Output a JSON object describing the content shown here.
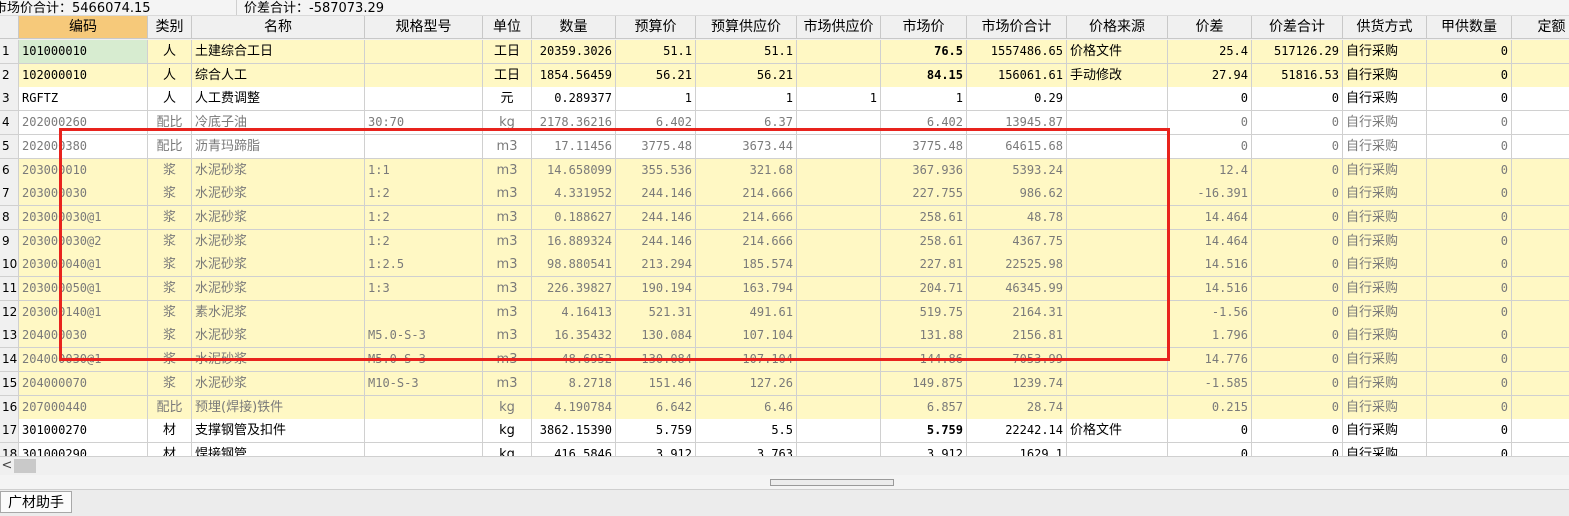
{
  "summary": {
    "market_total": "市场价合计：5466074.15",
    "diff_total": "价差合计：-587073.29"
  },
  "columns": [
    "",
    "编码",
    "类别",
    "名称",
    "规格型号",
    "单位",
    "数量",
    "预算价",
    "预算供应价",
    "市场供应价",
    "市场价",
    "市场价合计",
    "价格来源",
    "价差",
    "价差合计",
    "供货方式",
    "甲供数量",
    "定额"
  ],
  "rows": [
    {
      "n": "1",
      "code": "101000010",
      "cat": "人",
      "name": "土建综合工日",
      "spec": "",
      "unit": "工日",
      "qty": "20359.3026",
      "budget": "51.1",
      "budget_supply": "51.1",
      "market_supply": "",
      "market": "76.5",
      "market_total": "1557486.65",
      "source": "价格文件",
      "diff": "25.4",
      "diff_total": "517126.29",
      "supply": "自行采购",
      "a_qty": "0"
    },
    {
      "n": "2",
      "code": "102000010",
      "cat": "人",
      "name": "综合人工",
      "spec": "",
      "unit": "工日",
      "qty": "1854.56459",
      "budget": "56.21",
      "budget_supply": "56.21",
      "market_supply": "",
      "market": "84.15",
      "market_total": "156061.61",
      "source": "手动修改",
      "diff": "27.94",
      "diff_total": "51816.53",
      "supply": "自行采购",
      "a_qty": "0"
    },
    {
      "n": "3",
      "code": "RGFTZ",
      "cat": "人",
      "name": "人工费调整",
      "spec": "",
      "unit": "元",
      "qty": "0.289377",
      "budget": "1",
      "budget_supply": "1",
      "market_supply": "1",
      "market": "1",
      "market_total": "0.29",
      "source": "",
      "diff": "0",
      "diff_total": "0",
      "supply": "自行采购",
      "a_qty": "0"
    },
    {
      "n": "4",
      "code": "202000260",
      "cat": "配比",
      "name": "冷底子油",
      "spec": "30:70",
      "unit": "kg",
      "qty": "2178.36216",
      "budget": "6.402",
      "budget_supply": "6.37",
      "market_supply": "",
      "market": "6.402",
      "market_total": "13945.87",
      "source": "",
      "diff": "0",
      "diff_total": "0",
      "supply": "自行采购",
      "a_qty": "0"
    },
    {
      "n": "5",
      "code": "202000380",
      "cat": "配比",
      "name": "沥青玛蹄脂",
      "spec": "",
      "unit": "m3",
      "qty": "17.11456",
      "budget": "3775.48",
      "budget_supply": "3673.44",
      "market_supply": "",
      "market": "3775.48",
      "market_total": "64615.68",
      "source": "",
      "diff": "0",
      "diff_total": "0",
      "supply": "自行采购",
      "a_qty": "0"
    },
    {
      "n": "6",
      "code": "203000010",
      "cat": "浆",
      "name": "水泥砂浆",
      "spec": "1:1",
      "unit": "m3",
      "qty": "14.658099",
      "budget": "355.536",
      "budget_supply": "321.68",
      "market_supply": "",
      "market": "367.936",
      "market_total": "5393.24",
      "source": "",
      "diff": "12.4",
      "diff_total": "0",
      "supply": "自行采购",
      "a_qty": "0"
    },
    {
      "n": "7",
      "code": "203000030",
      "cat": "浆",
      "name": "水泥砂浆",
      "spec": "1:2",
      "unit": "m3",
      "qty": "4.331952",
      "budget": "244.146",
      "budget_supply": "214.666",
      "market_supply": "",
      "market": "227.755",
      "market_total": "986.62",
      "source": "",
      "diff": "-16.391",
      "diff_total": "0",
      "supply": "自行采购",
      "a_qty": "0"
    },
    {
      "n": "8",
      "code": "203000030@1",
      "cat": "浆",
      "name": "水泥砂浆",
      "spec": "1:2",
      "unit": "m3",
      "qty": "0.188627",
      "budget": "244.146",
      "budget_supply": "214.666",
      "market_supply": "",
      "market": "258.61",
      "market_total": "48.78",
      "source": "",
      "diff": "14.464",
      "diff_total": "0",
      "supply": "自行采购",
      "a_qty": "0"
    },
    {
      "n": "9",
      "code": "203000030@2",
      "cat": "浆",
      "name": "水泥砂浆",
      "spec": "1:2",
      "unit": "m3",
      "qty": "16.889324",
      "budget": "244.146",
      "budget_supply": "214.666",
      "market_supply": "",
      "market": "258.61",
      "market_total": "4367.75",
      "source": "",
      "diff": "14.464",
      "diff_total": "0",
      "supply": "自行采购",
      "a_qty": "0"
    },
    {
      "n": "10",
      "code": "203000040@1",
      "cat": "浆",
      "name": "水泥砂浆",
      "spec": "1:2.5",
      "unit": "m3",
      "qty": "98.880541",
      "budget": "213.294",
      "budget_supply": "185.574",
      "market_supply": "",
      "market": "227.81",
      "market_total": "22525.98",
      "source": "",
      "diff": "14.516",
      "diff_total": "0",
      "supply": "自行采购",
      "a_qty": "0"
    },
    {
      "n": "11",
      "code": "203000050@1",
      "cat": "浆",
      "name": "水泥砂浆",
      "spec": "1:3",
      "unit": "m3",
      "qty": "226.39827",
      "budget": "190.194",
      "budget_supply": "163.794",
      "market_supply": "",
      "market": "204.71",
      "market_total": "46345.99",
      "source": "",
      "diff": "14.516",
      "diff_total": "0",
      "supply": "自行采购",
      "a_qty": "0"
    },
    {
      "n": "12",
      "code": "203000140@1",
      "cat": "浆",
      "name": "素水泥浆",
      "spec": "",
      "unit": "m3",
      "qty": "4.16413",
      "budget": "521.31",
      "budget_supply": "491.61",
      "market_supply": "",
      "market": "519.75",
      "market_total": "2164.31",
      "source": "",
      "diff": "-1.56",
      "diff_total": "0",
      "supply": "自行采购",
      "a_qty": "0"
    },
    {
      "n": "13",
      "code": "204000030",
      "cat": "浆",
      "name": "水泥砂浆",
      "spec": "M5.0-S-3",
      "unit": "m3",
      "qty": "16.35432",
      "budget": "130.084",
      "budget_supply": "107.104",
      "market_supply": "",
      "market": "131.88",
      "market_total": "2156.81",
      "source": "",
      "diff": "1.796",
      "diff_total": "0",
      "supply": "自行采购",
      "a_qty": "0"
    },
    {
      "n": "14",
      "code": "204000030@1",
      "cat": "浆",
      "name": "水泥砂浆",
      "spec": "M5.0-S-3",
      "unit": "m3",
      "qty": "48.6952",
      "budget": "130.084",
      "budget_supply": "107.104",
      "market_supply": "",
      "market": "144.86",
      "market_total": "7053.99",
      "source": "",
      "diff": "14.776",
      "diff_total": "0",
      "supply": "自行采购",
      "a_qty": "0"
    },
    {
      "n": "15",
      "code": "204000070",
      "cat": "浆",
      "name": "水泥砂浆",
      "spec": "M10-S-3",
      "unit": "m3",
      "qty": "8.2718",
      "budget": "151.46",
      "budget_supply": "127.26",
      "market_supply": "",
      "market": "149.875",
      "market_total": "1239.74",
      "source": "",
      "diff": "-1.585",
      "diff_total": "0",
      "supply": "自行采购",
      "a_qty": "0"
    },
    {
      "n": "16",
      "code": "207000440",
      "cat": "配比",
      "name": "预埋(焊接)铁件",
      "spec": "",
      "unit": "kg",
      "qty": "4.190784",
      "budget": "6.642",
      "budget_supply": "6.46",
      "market_supply": "",
      "market": "6.857",
      "market_total": "28.74",
      "source": "",
      "diff": "0.215",
      "diff_total": "0",
      "supply": "自行采购",
      "a_qty": "0"
    },
    {
      "n": "17",
      "code": "301000270",
      "cat": "材",
      "name": "支撑钢管及扣件",
      "spec": "",
      "unit": "kg",
      "qty": "3862.15390",
      "budget": "5.759",
      "budget_supply": "5.5",
      "market_supply": "",
      "market": "5.759",
      "market_total": "22242.14",
      "source": "价格文件",
      "diff": "0",
      "diff_total": "0",
      "supply": "自行采购",
      "a_qty": "0"
    },
    {
      "n": "18",
      "code": "301000290",
      "cat": "材",
      "name": "焊接钢管",
      "spec": "",
      "unit": "kg",
      "qty": "416.5846",
      "budget": "3.912",
      "budget_supply": "3.763",
      "market_supply": "",
      "market": "3.912",
      "market_total": "1629.1",
      "source": "",
      "diff": "0",
      "diff_total": "0",
      "supply": "自行采购",
      "a_qty": "0"
    }
  ],
  "bottom_tab": "广材助手",
  "scroll_left_glyph": "<",
  "colors": {
    "highlight_yellow": "#fff8c4",
    "header_active": "#f6c97a",
    "selected_cell": "#d7ecd0",
    "annotation_red": "#e8231d"
  }
}
